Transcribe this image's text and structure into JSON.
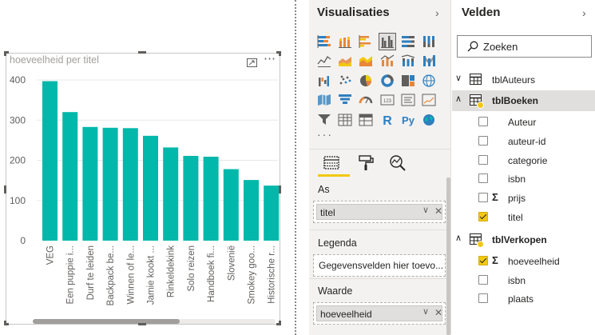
{
  "visual": {
    "title": "hoeveelheid per titel",
    "more_label": "⋯"
  },
  "chart_data": {
    "type": "bar",
    "title": "hoeveelheid per titel",
    "categories": [
      "VEG",
      "Een puppie i...",
      "Durf te leiden",
      "Backpack be...",
      "Winnen of le...",
      "Jamie kookt ...",
      "Rinkeldekink",
      "Solo reizen",
      "Handboek fi...",
      "Slovenië",
      "Smokey goo...",
      "Historische r..."
    ],
    "values": [
      397,
      320,
      283,
      281,
      280,
      261,
      232,
      211,
      209,
      178,
      151,
      137
    ],
    "y_ticks": [
      "400",
      "300",
      "200",
      "100",
      "0"
    ],
    "ylim": [
      0,
      400
    ],
    "bar_color": "#01b8aa",
    "grid": true
  },
  "visualizations": {
    "title": "Visualisaties",
    "chevron": "›",
    "icons": [
      "stacked-bar-chart-icon",
      "stacked-column-chart-icon",
      "clustered-bar-chart-icon",
      "clustered-column-chart-icon",
      "100-stacked-bar-chart-icon",
      "100-stacked-column-chart-icon",
      "line-chart-icon",
      "area-chart-icon",
      "stacked-area-chart-icon",
      "line-and-column-chart-icon",
      "line-and-stacked-column-chart-icon",
      "ribbon-chart-icon",
      "waterfall-chart-icon",
      "scatter-chart-icon",
      "pie-chart-icon",
      "donut-chart-icon",
      "treemap-icon",
      "map-icon",
      "filled-map-icon",
      "funnel-icon",
      "gauge-icon",
      "card-icon",
      "multi-row-card-icon",
      "kpi-icon",
      "slicer-icon",
      "table-visual-icon",
      "matrix-icon",
      "r-script-icon",
      "python-script-icon",
      "globe-icon"
    ],
    "selected_icon": 3,
    "r_label": "R",
    "py_label": "Py",
    "more_label": "···",
    "wells": {
      "axis_label": "As",
      "axis_value": "titel",
      "legend_label": "Legenda",
      "legend_placeholder": "Gegevensvelden hier toevo...",
      "value_label": "Waarde",
      "value_value": "hoeveelheid",
      "chip_chevron": "∨",
      "chip_close": "✕"
    },
    "accent_color": "#f2c811"
  },
  "fields": {
    "title": "Velden",
    "chevron": "›",
    "search_placeholder": "Zoeken",
    "tables": [
      {
        "name": "tblAuteurs",
        "caret": "∨",
        "expanded": false,
        "fields": []
      },
      {
        "name": "tblBoeken",
        "caret": "∧",
        "expanded": true,
        "fields": [
          {
            "name": "Auteur",
            "checked": false,
            "sigma": false
          },
          {
            "name": "auteur-id",
            "checked": false,
            "sigma": false
          },
          {
            "name": "categorie",
            "checked": false,
            "sigma": false
          },
          {
            "name": "isbn",
            "checked": false,
            "sigma": false
          },
          {
            "name": "prijs",
            "checked": false,
            "sigma": true
          },
          {
            "name": "titel",
            "checked": true,
            "sigma": false
          }
        ]
      },
      {
        "name": "tblVerkopen",
        "caret": "∧",
        "expanded": true,
        "fields": [
          {
            "name": "hoeveelheid",
            "checked": true,
            "sigma": true
          },
          {
            "name": "isbn",
            "checked": false,
            "sigma": false
          },
          {
            "name": "plaats",
            "checked": false,
            "sigma": false
          }
        ]
      }
    ],
    "sigma_symbol": "Σ"
  }
}
